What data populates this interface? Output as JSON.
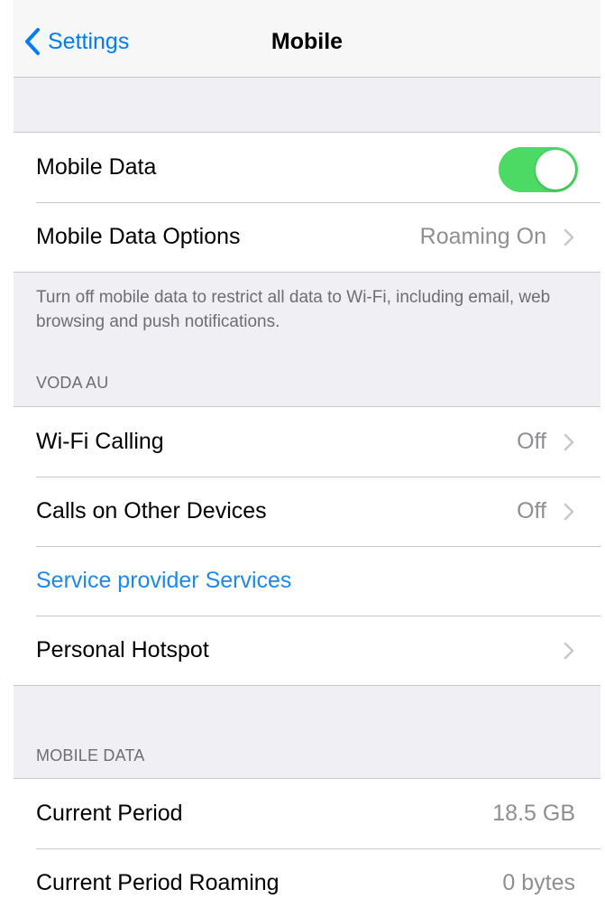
{
  "navbar": {
    "back_label": "Settings",
    "title": "Mobile"
  },
  "mobile_data_group": {
    "mobile_data_label": "Mobile Data",
    "mobile_data_enabled": true,
    "options_label": "Mobile Data Options",
    "options_value": "Roaming On"
  },
  "mobile_data_footer": "Turn off mobile data to restrict all data to Wi-Fi, including email, web browsing and push notifications.",
  "carrier_section": {
    "header": "VODA AU",
    "wifi_calling_label": "Wi-Fi Calling",
    "wifi_calling_value": "Off",
    "other_devices_label": "Calls on Other Devices",
    "other_devices_value": "Off",
    "provider_services_label": "Service provider Services",
    "hotspot_label": "Personal Hotspot"
  },
  "usage_section": {
    "header": "MOBILE DATA",
    "current_period_label": "Current Period",
    "current_period_value": "18.5 GB",
    "roaming_label": "Current Period Roaming",
    "roaming_value": "0 bytes"
  },
  "colors": {
    "accent": "#007aff",
    "toggle_on": "#4cd964",
    "link_text": "#1e88e5",
    "secondary_text": "#8e8e93",
    "grouped_background": "#efeff4"
  }
}
